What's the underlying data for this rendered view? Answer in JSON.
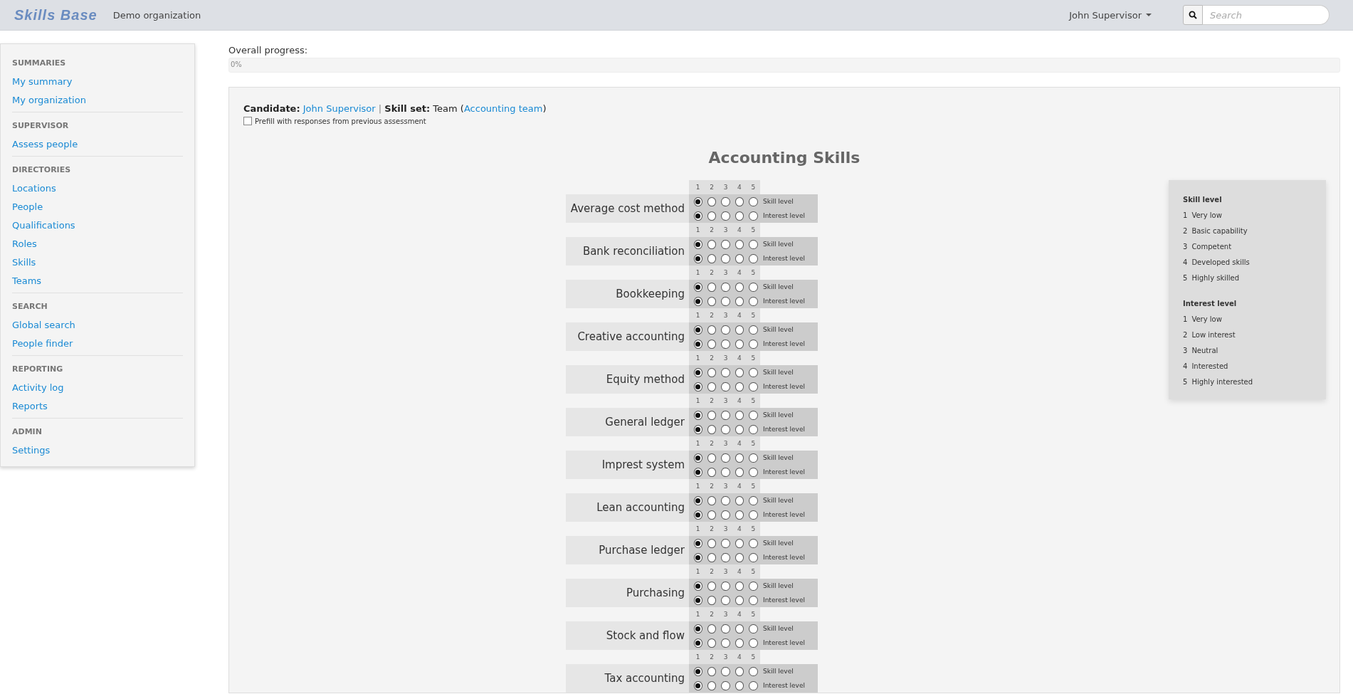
{
  "topbar": {
    "logo": "Skills Base",
    "organization": "Demo organization",
    "user": "John Supervisor",
    "search": {
      "placeholder": "Search"
    }
  },
  "sidebar": {
    "sections": [
      {
        "title": "SUMMARIES",
        "items": [
          "My summary",
          "My organization"
        ]
      },
      {
        "title": "SUPERVISOR",
        "items": [
          "Assess people"
        ]
      },
      {
        "title": "DIRECTORIES",
        "items": [
          "Locations",
          "People",
          "Qualifications",
          "Roles",
          "Skills",
          "Teams"
        ]
      },
      {
        "title": "SEARCH",
        "items": [
          "Global search",
          "People finder"
        ]
      },
      {
        "title": "REPORTING",
        "items": [
          "Activity log",
          "Reports"
        ]
      },
      {
        "title": "ADMIN",
        "items": [
          "Settings"
        ]
      }
    ]
  },
  "progress": {
    "label": "Overall progress:",
    "text": "0%",
    "level": 0
  },
  "assessment": {
    "candidate_label": "Candidate:",
    "candidate": "John Supervisor",
    "separator": "|",
    "skill_set_label": "Skill set:",
    "skill_set_prefix": "Team (",
    "skill_set_link": "Accounting team",
    "skill_set_suffix": ")",
    "prefill": {
      "label": "Prefill with responses from previous assessment",
      "checked": false
    },
    "title": "Accounting Skills",
    "skills": [
      {
        "name": "Average cost method",
        "scale": [
          "1",
          "2",
          "3",
          "4",
          "5"
        ],
        "rows": [
          {
            "label": "Skill level",
            "options": [
              {
                "selected": true
              },
              {
                "selected": false
              },
              {
                "selected": false
              },
              {
                "selected": false
              },
              {
                "selected": false
              }
            ]
          },
          {
            "label": "Interest level",
            "options": [
              {
                "selected": true
              },
              {
                "selected": false
              },
              {
                "selected": false
              },
              {
                "selected": false
              },
              {
                "selected": false
              }
            ]
          }
        ]
      },
      {
        "name": "Bank reconciliation",
        "scale": [
          "1",
          "2",
          "3",
          "4",
          "5"
        ],
        "rows": [
          {
            "label": "Skill level",
            "options": [
              {
                "selected": true
              },
              {
                "selected": false
              },
              {
                "selected": false
              },
              {
                "selected": false
              },
              {
                "selected": false
              }
            ]
          },
          {
            "label": "Interest level",
            "options": [
              {
                "selected": true
              },
              {
                "selected": false
              },
              {
                "selected": false
              },
              {
                "selected": false
              },
              {
                "selected": false
              }
            ]
          }
        ]
      },
      {
        "name": "Bookkeeping",
        "scale": [
          "1",
          "2",
          "3",
          "4",
          "5"
        ],
        "rows": [
          {
            "label": "Skill level",
            "options": [
              {
                "selected": true
              },
              {
                "selected": false
              },
              {
                "selected": false
              },
              {
                "selected": false
              },
              {
                "selected": false
              }
            ]
          },
          {
            "label": "Interest level",
            "options": [
              {
                "selected": true
              },
              {
                "selected": false
              },
              {
                "selected": false
              },
              {
                "selected": false
              },
              {
                "selected": false
              }
            ]
          }
        ]
      },
      {
        "name": "Creative accounting",
        "scale": [
          "1",
          "2",
          "3",
          "4",
          "5"
        ],
        "rows": [
          {
            "label": "Skill level",
            "options": [
              {
                "selected": true
              },
              {
                "selected": false
              },
              {
                "selected": false
              },
              {
                "selected": false
              },
              {
                "selected": false
              }
            ]
          },
          {
            "label": "Interest level",
            "options": [
              {
                "selected": true
              },
              {
                "selected": false
              },
              {
                "selected": false
              },
              {
                "selected": false
              },
              {
                "selected": false
              }
            ]
          }
        ]
      },
      {
        "name": "Equity method",
        "scale": [
          "1",
          "2",
          "3",
          "4",
          "5"
        ],
        "rows": [
          {
            "label": "Skill level",
            "options": [
              {
                "selected": true
              },
              {
                "selected": false
              },
              {
                "selected": false
              },
              {
                "selected": false
              },
              {
                "selected": false
              }
            ]
          },
          {
            "label": "Interest level",
            "options": [
              {
                "selected": true
              },
              {
                "selected": false
              },
              {
                "selected": false
              },
              {
                "selected": false
              },
              {
                "selected": false
              }
            ]
          }
        ]
      },
      {
        "name": "General ledger",
        "scale": [
          "1",
          "2",
          "3",
          "4",
          "5"
        ],
        "rows": [
          {
            "label": "Skill level",
            "options": [
              {
                "selected": true
              },
              {
                "selected": false
              },
              {
                "selected": false
              },
              {
                "selected": false
              },
              {
                "selected": false
              }
            ]
          },
          {
            "label": "Interest level",
            "options": [
              {
                "selected": true
              },
              {
                "selected": false
              },
              {
                "selected": false
              },
              {
                "selected": false
              },
              {
                "selected": false
              }
            ]
          }
        ]
      },
      {
        "name": "Imprest system",
        "scale": [
          "1",
          "2",
          "3",
          "4",
          "5"
        ],
        "rows": [
          {
            "label": "Skill level",
            "options": [
              {
                "selected": true
              },
              {
                "selected": false
              },
              {
                "selected": false
              },
              {
                "selected": false
              },
              {
                "selected": false
              }
            ]
          },
          {
            "label": "Interest level",
            "options": [
              {
                "selected": true
              },
              {
                "selected": false
              },
              {
                "selected": false
              },
              {
                "selected": false
              },
              {
                "selected": false
              }
            ]
          }
        ]
      },
      {
        "name": "Lean accounting",
        "scale": [
          "1",
          "2",
          "3",
          "4",
          "5"
        ],
        "rows": [
          {
            "label": "Skill level",
            "options": [
              {
                "selected": true
              },
              {
                "selected": false
              },
              {
                "selected": false
              },
              {
                "selected": false
              },
              {
                "selected": false
              }
            ]
          },
          {
            "label": "Interest level",
            "options": [
              {
                "selected": true
              },
              {
                "selected": false
              },
              {
                "selected": false
              },
              {
                "selected": false
              },
              {
                "selected": false
              }
            ]
          }
        ]
      },
      {
        "name": "Purchase ledger",
        "scale": [
          "1",
          "2",
          "3",
          "4",
          "5"
        ],
        "rows": [
          {
            "label": "Skill level",
            "options": [
              {
                "selected": true
              },
              {
                "selected": false
              },
              {
                "selected": false
              },
              {
                "selected": false
              },
              {
                "selected": false
              }
            ]
          },
          {
            "label": "Interest level",
            "options": [
              {
                "selected": true
              },
              {
                "selected": false
              },
              {
                "selected": false
              },
              {
                "selected": false
              },
              {
                "selected": false
              }
            ]
          }
        ]
      },
      {
        "name": "Purchasing",
        "scale": [
          "1",
          "2",
          "3",
          "4",
          "5"
        ],
        "rows": [
          {
            "label": "Skill level",
            "options": [
              {
                "selected": true
              },
              {
                "selected": false
              },
              {
                "selected": false
              },
              {
                "selected": false
              },
              {
                "selected": false
              }
            ]
          },
          {
            "label": "Interest level",
            "options": [
              {
                "selected": true
              },
              {
                "selected": false
              },
              {
                "selected": false
              },
              {
                "selected": false
              },
              {
                "selected": false
              }
            ]
          }
        ]
      },
      {
        "name": "Stock and flow",
        "scale": [
          "1",
          "2",
          "3",
          "4",
          "5"
        ],
        "rows": [
          {
            "label": "Skill level",
            "options": [
              {
                "selected": true
              },
              {
                "selected": false
              },
              {
                "selected": false
              },
              {
                "selected": false
              },
              {
                "selected": false
              }
            ]
          },
          {
            "label": "Interest level",
            "options": [
              {
                "selected": true
              },
              {
                "selected": false
              },
              {
                "selected": false
              },
              {
                "selected": false
              },
              {
                "selected": false
              }
            ]
          }
        ]
      },
      {
        "name": "Tax accounting",
        "scale": [
          "1",
          "2",
          "3",
          "4",
          "5"
        ],
        "rows": [
          {
            "label": "Skill level",
            "options": [
              {
                "selected": true
              },
              {
                "selected": false
              },
              {
                "selected": false
              },
              {
                "selected": false
              },
              {
                "selected": false
              }
            ]
          },
          {
            "label": "Interest level",
            "options": [
              {
                "selected": true
              },
              {
                "selected": false
              },
              {
                "selected": false
              },
              {
                "selected": false
              },
              {
                "selected": false
              }
            ]
          }
        ]
      }
    ],
    "legend": [
      {
        "title": "Skill level",
        "items": [
          {
            "number": "1",
            "label": "Very low"
          },
          {
            "number": "2",
            "label": "Basic capability"
          },
          {
            "number": "3",
            "label": "Competent"
          },
          {
            "number": "4",
            "label": "Developed skills"
          },
          {
            "number": "5",
            "label": "Highly skilled"
          }
        ]
      },
      {
        "title": "Interest level",
        "items": [
          {
            "number": "1",
            "label": "Very low"
          },
          {
            "number": "2",
            "label": "Low interest"
          },
          {
            "number": "3",
            "label": "Neutral"
          },
          {
            "number": "4",
            "label": "Interested"
          },
          {
            "number": "5",
            "label": "Highly interested"
          }
        ]
      }
    ]
  }
}
